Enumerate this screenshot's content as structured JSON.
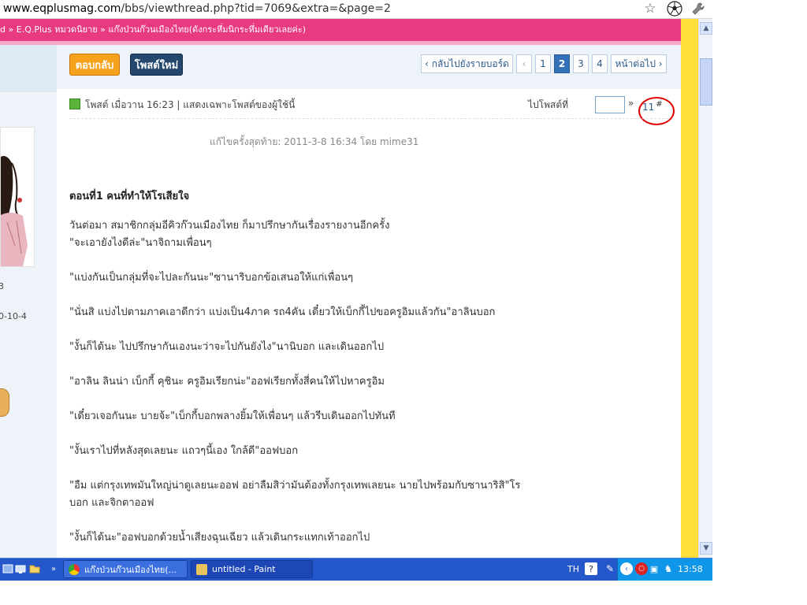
{
  "browser": {
    "url_host": "www.eqplusmag.com",
    "url_path": "/bbs/viewthread.php?tid=7069&extra=&page=2",
    "icons": [
      "bookmark-star-icon",
      "soccer-ball-icon",
      "wrench-icon"
    ]
  },
  "breadcrumb": {
    "text": "ld » E.Q.Plus หมวดนิยาย » แก๊งป่วนก๊วนเมืองไทย(ดังกระหึ่มนิกระหึ่มเดียวเลยค่ะ)"
  },
  "colors": {
    "breadcrumb_bg": "#e83a80",
    "gutter": "#ffe03a",
    "reply_button": "#f7a21c",
    "newpost_button": "#24476e",
    "taskbar": "#2457c9",
    "annotation": "#e00000"
  },
  "leftcol": {
    "line1": "3",
    "line2": "0-10-4"
  },
  "actions": {
    "reply_label": "ตอบกลับ",
    "newpost_label": "โพสต์ใหม่"
  },
  "pagination": {
    "back_label": "‹ กลับไปยังรายบอร์ด",
    "prev_label": "‹",
    "pages": [
      "1",
      "2",
      "3",
      "4"
    ],
    "current": "2",
    "next_label": "หน้าต่อไป ›"
  },
  "post": {
    "meta": "โพสต์ เมื่อวาน 16:23  |  แสดงเฉพาะโพสต์ของผู้ใช้นี้",
    "goto_label": "ไปโพสต์ที่",
    "goto_value": "",
    "goto_arrow": "»",
    "number": "11",
    "number_suffix": "#",
    "last_edit": "แก้ไขครั้งสุดท้าย: 2011-3-8 16:34 โดย mime31",
    "chapter_title": "ตอนที่1 คนที่ทำให้โรเสียใจ",
    "paragraphs": [
      "วันต่อมา สมาชิกกลุ่มอีคิวก๊วนเมืองไทย ก็มาปรึกษากันเรื่องรายงานอีกครั้ง",
      "\"จะเอายังไงดีล่ะ\"นาจิถามเพื่อนๆ",
      "\"แบ่งกันเป็นกลุ่มที่จะไปละกันนะ\"ซานาริบอกข้อเสนอให้แก่เพื่อนๆ",
      "\"นั่นสิ แบ่งไปตามภาคเอาดีกว่า แบ่งเป็น4ภาค รถ4คัน เดี๋ยวให้เบ็กกี้ไปขอครูอิมแล้วกัน\"อาลินบอก",
      "\"งั้นก็ได้นะ ไปปรึกษากันเองนะว่าจะไปกันยังไง\"นานิบอก และเดินออกไป",
      "\"อาลิน ลินน่า เบ็กกี้ คุชินะ ครูอิมเรียกน่ะ\"ออฟเรียกทั้งสี่คนให้ไปหาครูอิม",
      "\"เดี๋ยวเจอกันนะ บายจ้ะ\"เบ็กกี้บอกพลางยิ้มให้เพื่อนๆ แล้วรีบเดินออกไปทันที",
      "\"งั้นเราไปที่หลังสุดเลยนะ แถวๆนี้เอง ใกล้ดี\"ออฟบอก",
      "\"อืม แต่กรุงเทพมันใหญ่น่าดูเลยนะออฟ อย่าลืมสิว่ามันต้องทั้งกรุงเทพเลยนะ นายไปพร้อมกับซานาริสิ\"โร",
      "บอก และจิกตาออฟ",
      "\"งั้นก็ได้นะ\"ออฟบอกด้วยน้ำเสียงฉุนเฉียว แล้วเดินกระแทกเท้าออกไป"
    ]
  },
  "taskbar": {
    "task1_label": "แก๊งป่วนก๊วนเมืองไทย(...",
    "task2_label": "untitled - Paint",
    "language": "TH",
    "clock": "13:58"
  }
}
